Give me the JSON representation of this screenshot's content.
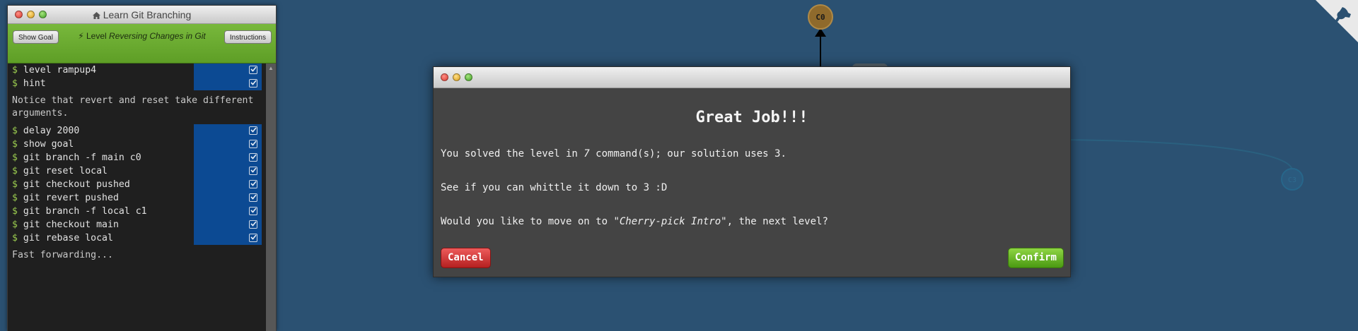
{
  "window": {
    "title": "Learn Git Branching",
    "icon": "home-icon"
  },
  "level_bar": {
    "show_goal_label": "Show Goal",
    "instructions_label": "Instructions",
    "level_prefix": "Level",
    "level_name": "Reversing Changes in Git",
    "icon": "bolt-icon"
  },
  "terminal": {
    "prompt": "$",
    "group1": [
      {
        "cmd": "level rampup4"
      },
      {
        "cmd": "hint"
      }
    ],
    "message1": "Notice that revert and reset take different arguments.",
    "group2": [
      {
        "cmd": "delay 2000"
      },
      {
        "cmd": "show goal"
      },
      {
        "cmd": "git branch -f main c0"
      },
      {
        "cmd": "git reset local"
      },
      {
        "cmd": "git checkout pushed"
      },
      {
        "cmd": "git revert pushed"
      },
      {
        "cmd": "git branch -f local c1"
      },
      {
        "cmd": "git checkout main"
      },
      {
        "cmd": "git rebase local"
      }
    ],
    "message2": "Fast forwarding..."
  },
  "graph": {
    "commit_c0": "C0",
    "commit_right": "C3",
    "colors": {
      "background": "#2b5172",
      "commit_fill": "#8f6a2c"
    }
  },
  "modal": {
    "title": "Great Job!!!",
    "line1_before": "You solved the level in ",
    "line1_count": "7",
    "line1_after": " command(s); our solution uses 3.",
    "line2": "See if you can whittle it down to 3 :D",
    "line3_before": "Would you like to move on to ",
    "line3_level": "\"Cherry-pick Intro\"",
    "line3_after": ", the next level?",
    "cancel_label": "Cancel",
    "confirm_label": "Confirm"
  }
}
